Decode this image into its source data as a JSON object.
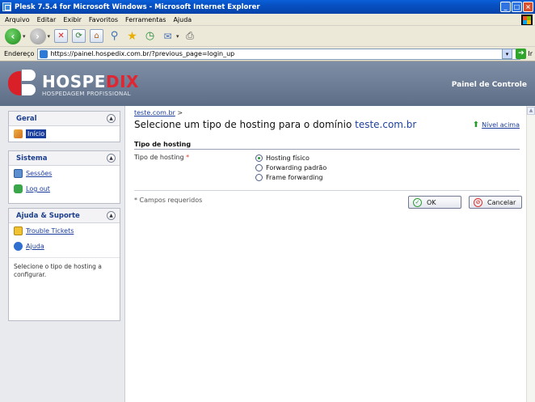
{
  "window": {
    "title": "Plesk 7.5.4 for Microsoft Windows - Microsoft Internet Explorer",
    "controls": [
      "_",
      "□",
      "×"
    ]
  },
  "menubar": {
    "items": [
      "Arquivo",
      "Editar",
      "Exibir",
      "Favoritos",
      "Ferramentas",
      "Ajuda"
    ]
  },
  "toolbar": {
    "icons": [
      "back-icon",
      "forward-icon",
      "stop-icon",
      "refresh-icon",
      "home-icon",
      "search-icon",
      "favorites-icon",
      "history-icon",
      "mail-icon",
      "print-icon"
    ]
  },
  "addressbar": {
    "label": "Endereço",
    "url": "https://painel.hospedix.com.br/?previous_page=login_up",
    "go_label": "Ir"
  },
  "header": {
    "brand_name_main": "HOSPE",
    "brand_name_accent": "DIX",
    "tagline": "HOSPEDAGEM PROFISSIONAL",
    "panel_title": "Painel de Controle",
    "colors": {
      "banner": "#6f7f98",
      "accent": "#e02630"
    }
  },
  "sidebar": {
    "boxes": [
      {
        "title": "Geral",
        "items": [
          {
            "label": "Início"
          }
        ]
      },
      {
        "title": "Sistema",
        "items": [
          {
            "label": "Sessões"
          },
          {
            "label": "Log out"
          }
        ]
      },
      {
        "title": "Ajuda & Suporte",
        "items": [
          {
            "label": "Trouble Tickets"
          },
          {
            "label": "Ajuda"
          }
        ],
        "help_text": "Selecione o tipo de hosting a configurar."
      }
    ]
  },
  "main": {
    "breadcrumb": {
      "link": "teste.com.br",
      "separator": ">"
    },
    "title_prefix": "Selecione um tipo de hosting para o domínio",
    "title_domain": "teste.com.br",
    "up_link": "Nível acima",
    "section_title": "Tipo de hosting",
    "field_label": "Tipo de hosting",
    "required_mark": "*",
    "options": [
      {
        "label": "Hosting físico",
        "checked": true
      },
      {
        "label": "Forwarding padrão",
        "checked": false
      },
      {
        "label": "Frame forwarding",
        "checked": false
      }
    ],
    "required_note": "* Campos requeridos",
    "ok_label": "OK",
    "cancel_label": "Cancelar"
  }
}
